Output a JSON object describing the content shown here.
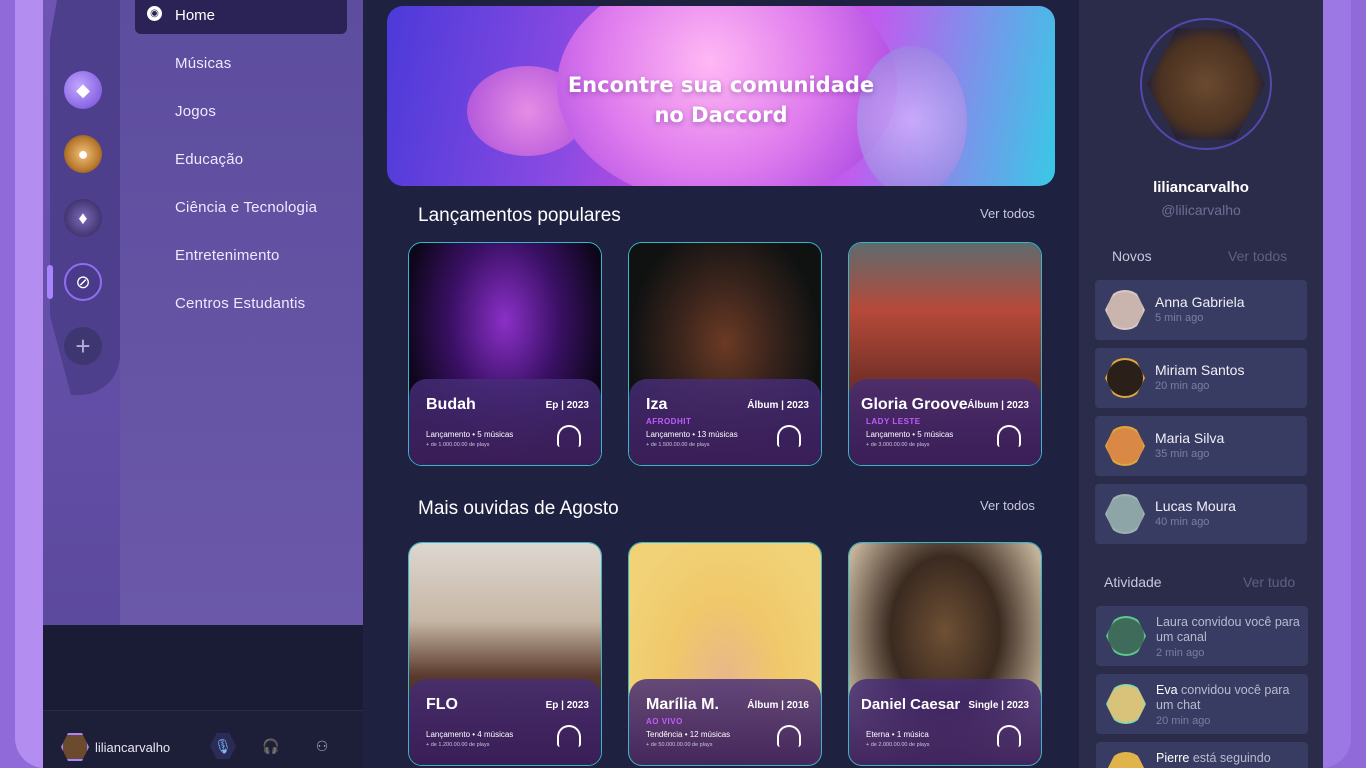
{
  "nav": {
    "home": "Home",
    "items": [
      "Músicas",
      "Jogos",
      "Educação",
      "Ciência e Tecnologia",
      "Entretenimento",
      "Centros Estudantis"
    ]
  },
  "user": {
    "name": "liliancarvalho"
  },
  "banner": {
    "line1": "Encontre sua comunidade",
    "line2": "no Daccord"
  },
  "sections": [
    {
      "title": "Lançamentos populares",
      "see_all": "Ver todos",
      "cards": [
        {
          "name": "Budah",
          "meta": "Ep | 2023",
          "tag": "",
          "line": "Lançamento • 5 músicas",
          "plays": "+ de 1.000.00.00 de plays"
        },
        {
          "name": "Iza",
          "meta": "Álbum | 2023",
          "tag": "AFRODHIT",
          "line": "Lançamento • 13 músicas",
          "plays": "+ de 1.500.00.00 de plays"
        },
        {
          "name": "Gloria Groove",
          "meta": "Álbum | 2023",
          "tag": "LADY LESTE",
          "line": "Lançamento • 5 músicas",
          "plays": "+ de 3.000.00.00 de plays"
        }
      ]
    },
    {
      "title": "Mais ouvidas de Agosto",
      "see_all": "Ver todos",
      "cards": [
        {
          "name": "FLO",
          "meta": "Ep | 2023",
          "tag": "",
          "line": "Lançamento • 4 músicas",
          "plays": "+ de 1.200.00.00 de plays"
        },
        {
          "name": "Marília M.",
          "meta": "Álbum | 2016",
          "tag": "AO VIVO",
          "line": "Tendência • 12 músicas",
          "plays": "+ de 50.000.00.00 de plays"
        },
        {
          "name": "Daniel Caesar",
          "meta": "Single | 2023",
          "tag": "",
          "line": "Eterna • 1 música",
          "plays": "+ de 2.000.00.00 de plays"
        }
      ]
    }
  ],
  "profile": {
    "name": "liliancarvalho",
    "handle": "@lilicarvalho"
  },
  "novos": {
    "title": "Novos",
    "see_all": "Ver todos",
    "items": [
      {
        "name": "Anna Gabriela",
        "time": "5 min ago"
      },
      {
        "name": "Miriam Santos",
        "time": "20 min ago"
      },
      {
        "name": "Maria Silva",
        "time": "35 min ago"
      },
      {
        "name": "Lucas Moura",
        "time": "40 min ago"
      }
    ]
  },
  "atividade": {
    "title": "Atividade",
    "see_all": "Ver tudo",
    "items": [
      {
        "actor": "",
        "text": "Laura convidou você para um canal",
        "time": "2 min ago"
      },
      {
        "actor": "Eva",
        "text": " convidou você para um chat",
        "time": "20 min ago"
      },
      {
        "actor": "Pierre",
        "text": " está seguindo",
        "time": ""
      }
    ]
  },
  "colors": {
    "accent": "#a885ff",
    "frame": "#9b78e3",
    "card_border": "#36b8c8",
    "tag": "#c25bff"
  }
}
